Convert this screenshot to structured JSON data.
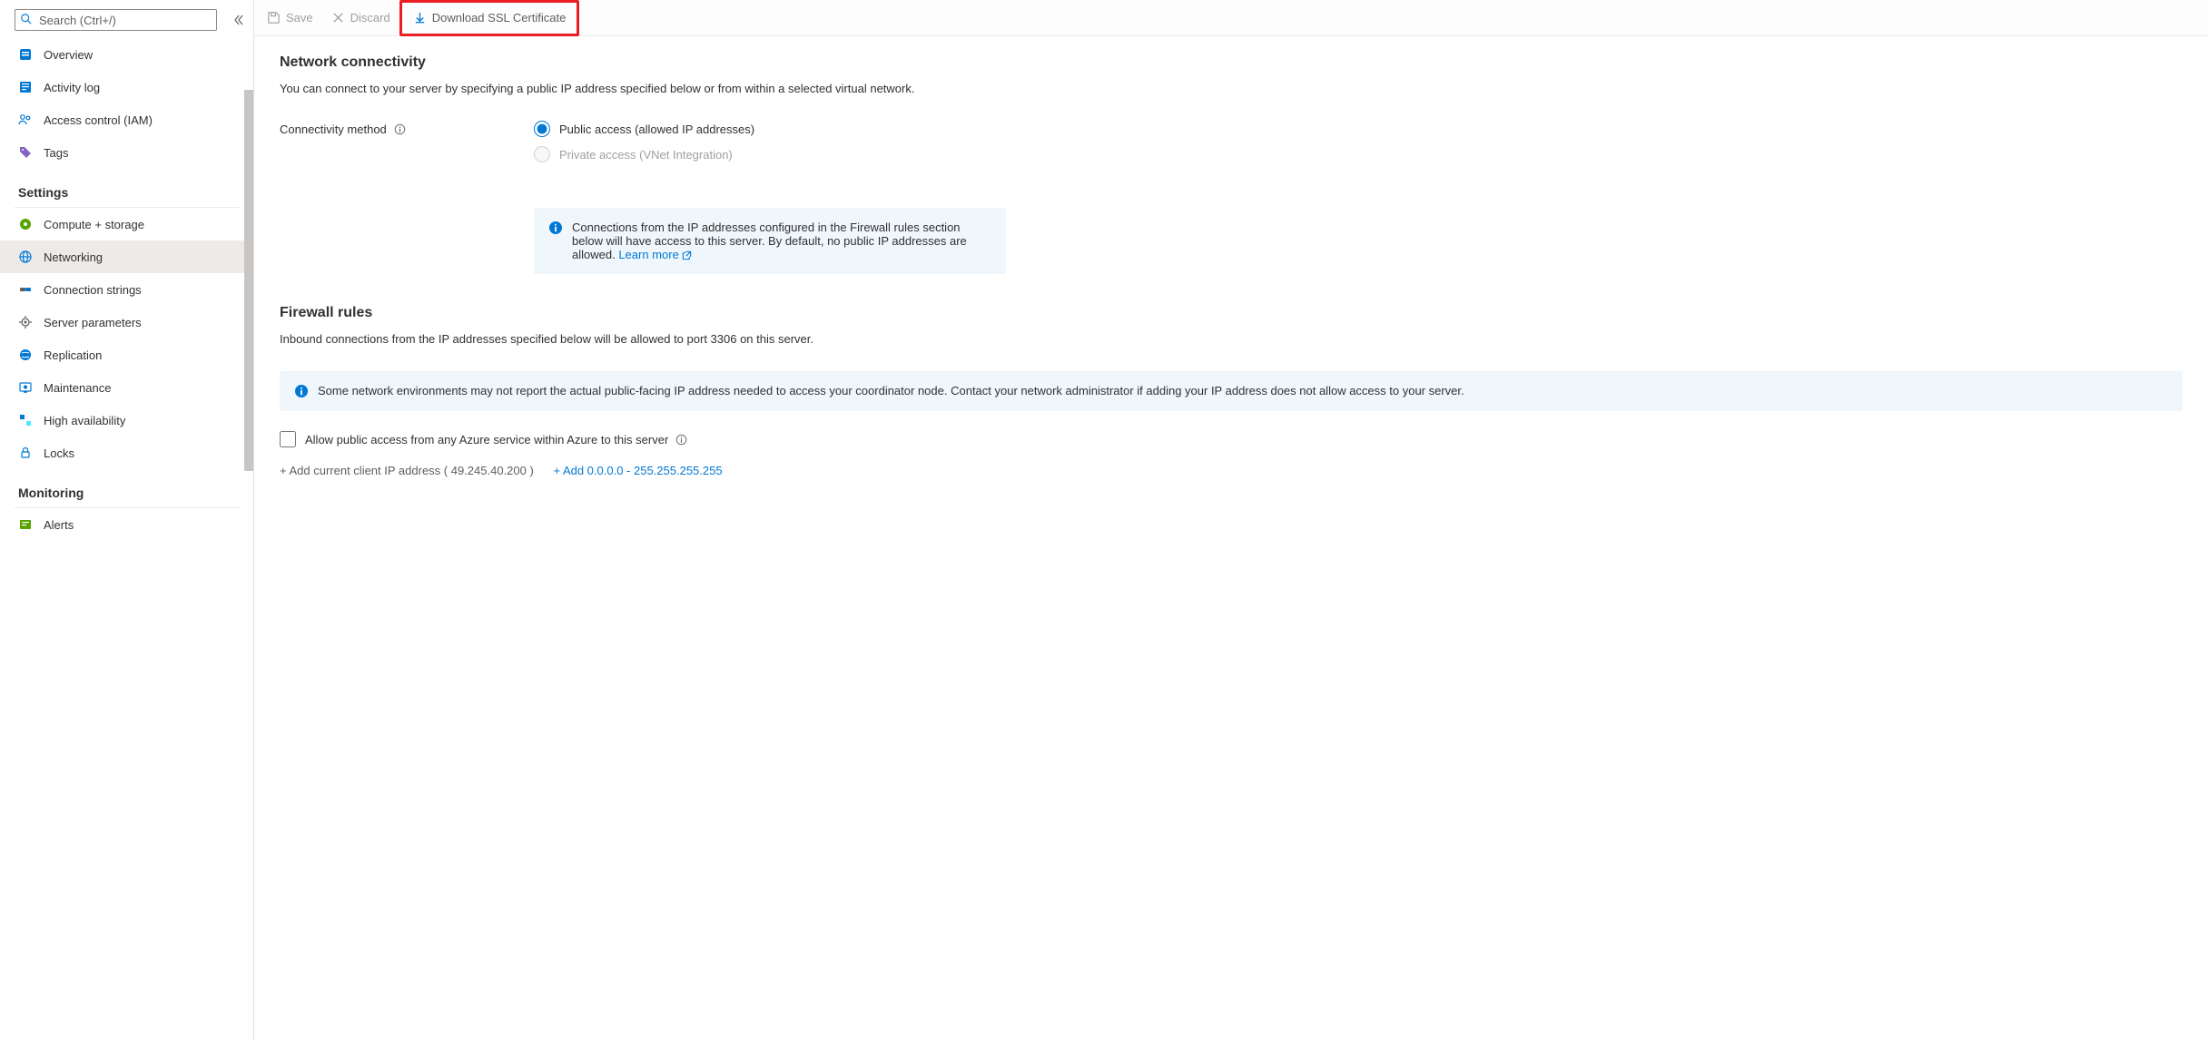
{
  "sidebar": {
    "search_placeholder": "Search (Ctrl+/)",
    "top_items": [
      {
        "key": "overview",
        "label": "Overview"
      },
      {
        "key": "activity",
        "label": "Activity log"
      },
      {
        "key": "iam",
        "label": "Access control (IAM)"
      },
      {
        "key": "tags",
        "label": "Tags"
      }
    ],
    "sections": [
      {
        "title": "Settings",
        "items": [
          {
            "key": "compute",
            "label": "Compute + storage"
          },
          {
            "key": "networking",
            "label": "Networking",
            "active": true
          },
          {
            "key": "connstrings",
            "label": "Connection strings"
          },
          {
            "key": "serverparams",
            "label": "Server parameters"
          },
          {
            "key": "replication",
            "label": "Replication"
          },
          {
            "key": "maintenance",
            "label": "Maintenance"
          },
          {
            "key": "ha",
            "label": "High availability"
          },
          {
            "key": "locks",
            "label": "Locks"
          }
        ]
      },
      {
        "title": "Monitoring",
        "items": [
          {
            "key": "alerts",
            "label": "Alerts"
          }
        ]
      }
    ]
  },
  "toolbar": {
    "save": "Save",
    "discard": "Discard",
    "download": "Download SSL Certificate"
  },
  "content": {
    "network_h": "Network connectivity",
    "network_desc": "You can connect to your server by specifying a public IP address specified below or from within a selected virtual network.",
    "conn_method_label": "Connectivity method",
    "radio_public": "Public access (allowed IP addresses)",
    "radio_private": "Private access (VNet Integration)",
    "ip_info": "Connections from the IP addresses configured in the Firewall rules section below will have access to this server. By default, no public IP addresses are allowed.",
    "learn_more": "Learn more",
    "firewall_h": "Firewall rules",
    "firewall_desc": "Inbound connections from the IP addresses specified below will be allowed to port 3306 on this server.",
    "env_info": "Some network environments may not report the actual public-facing IP address needed to access your coordinator node. Contact your network administrator if adding your IP address does not allow access to your server.",
    "allow_azure": "Allow public access from any Azure service within Azure to this server",
    "add_current_prefix": "+ Add current client IP address ( ",
    "client_ip": "49.245.40.200",
    "add_current_suffix": " )",
    "add_range": "+ Add 0.0.0.0 - 255.255.255.255"
  }
}
